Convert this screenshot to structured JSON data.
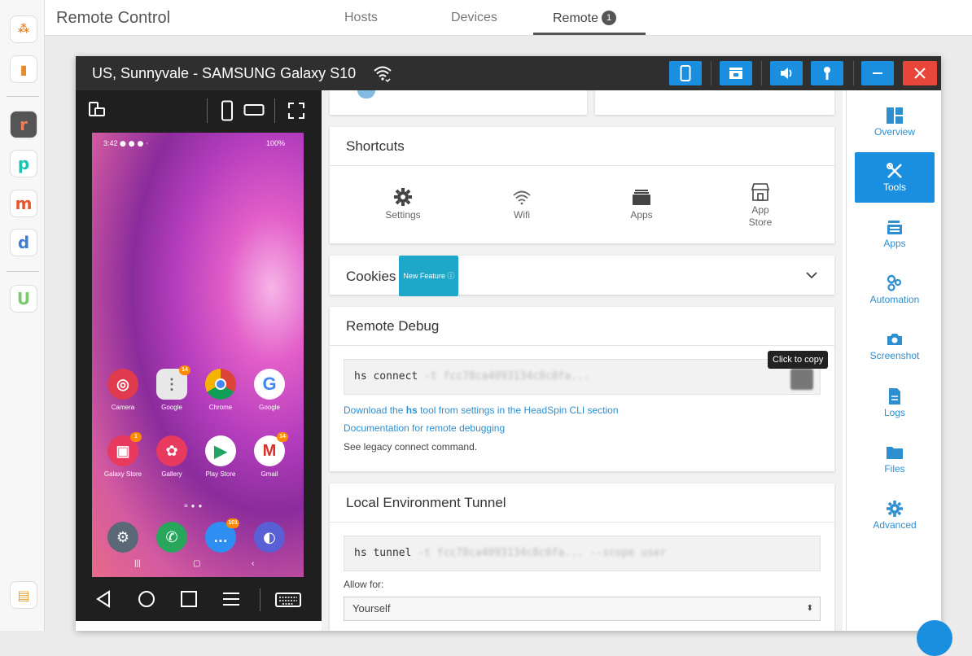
{
  "app": {
    "title": "Remote Control"
  },
  "tabs": [
    {
      "label": "Hosts"
    },
    {
      "label": "Devices"
    },
    {
      "label": "Remote",
      "badge": "1"
    }
  ],
  "rail": [
    "apps-icon",
    "chart-icon",
    "r-app-icon",
    "p-app-icon",
    "m-app-icon",
    "d-app-icon",
    "u-app-icon",
    "doc-icon"
  ],
  "device": {
    "title": "US, Sunnyvale - SAMSUNG Galaxy S10",
    "status_time": "3:42",
    "status_right": "100%",
    "home_row1": [
      {
        "label": "Camera",
        "color": "#e03a4e",
        "glyph": "◎"
      },
      {
        "label": "Google",
        "color": "#e8e8e8",
        "glyph": "⋮",
        "badge": "14"
      },
      {
        "label": "Chrome",
        "color": "#ffffff",
        "glyph": "◉"
      },
      {
        "label": "Google",
        "color": "#ffffff",
        "glyph": "G"
      }
    ],
    "home_row2": [
      {
        "label": "Galaxy Store",
        "color": "#e8395f",
        "glyph": "▣",
        "badge": "1"
      },
      {
        "label": "Gallery",
        "color": "#e8395f",
        "glyph": "✿"
      },
      {
        "label": "Play Store",
        "color": "#ffffff",
        "glyph": "▶"
      },
      {
        "label": "Gmail",
        "color": "#ffffff",
        "glyph": "M",
        "badge": "14"
      }
    ],
    "dock": [
      {
        "label": "",
        "color": "#5b6877",
        "glyph": "⚙"
      },
      {
        "label": "",
        "color": "#27a65c",
        "glyph": "✆"
      },
      {
        "label": "",
        "color": "#2f8ef2",
        "glyph": "…",
        "badge": "101"
      },
      {
        "label": "",
        "color": "#5a5fd6",
        "glyph": "◐"
      }
    ]
  },
  "shortcuts": {
    "title": "Shortcuts",
    "items": [
      "Settings",
      "Wifi",
      "Apps",
      "App Store"
    ]
  },
  "cookies": {
    "title": "Cookies",
    "badge": "New Feature"
  },
  "remote_debug": {
    "title": "Remote Debug",
    "command": "hs connect",
    "command_args": "-t fcc78ca4093134c8c0fa...",
    "tooltip": "Click to copy",
    "link1_prefix": "Download the ",
    "link1_bold": "hs",
    "link1_suffix": " tool from settings in the HeadSpin CLI section",
    "link2": "Documentation for remote debugging",
    "legacy": "See legacy connect command."
  },
  "tunnel": {
    "title": "Local Environment Tunnel",
    "command": "hs tunnel",
    "command_args": "-t fcc78ca4093134c8c0fa... --scope user",
    "allow_label": "Allow for:",
    "allow_value": "Yourself"
  },
  "sidebar": [
    {
      "label": "Overview",
      "icon": "overview-icon"
    },
    {
      "label": "Tools",
      "icon": "tools-icon",
      "active": true
    },
    {
      "label": "Apps",
      "icon": "apps-icon"
    },
    {
      "label": "Automation",
      "icon": "automation-icon"
    },
    {
      "label": "Screenshot",
      "icon": "camera-icon"
    },
    {
      "label": "Logs",
      "icon": "logs-icon"
    },
    {
      "label": "Files",
      "icon": "folder-icon"
    },
    {
      "label": "Advanced",
      "icon": "gear-icon"
    }
  ],
  "colors": {
    "accent": "#1a8fe0",
    "close": "#e8463a",
    "titlebar": "#2f2f2f",
    "link": "#2e8fd0"
  }
}
